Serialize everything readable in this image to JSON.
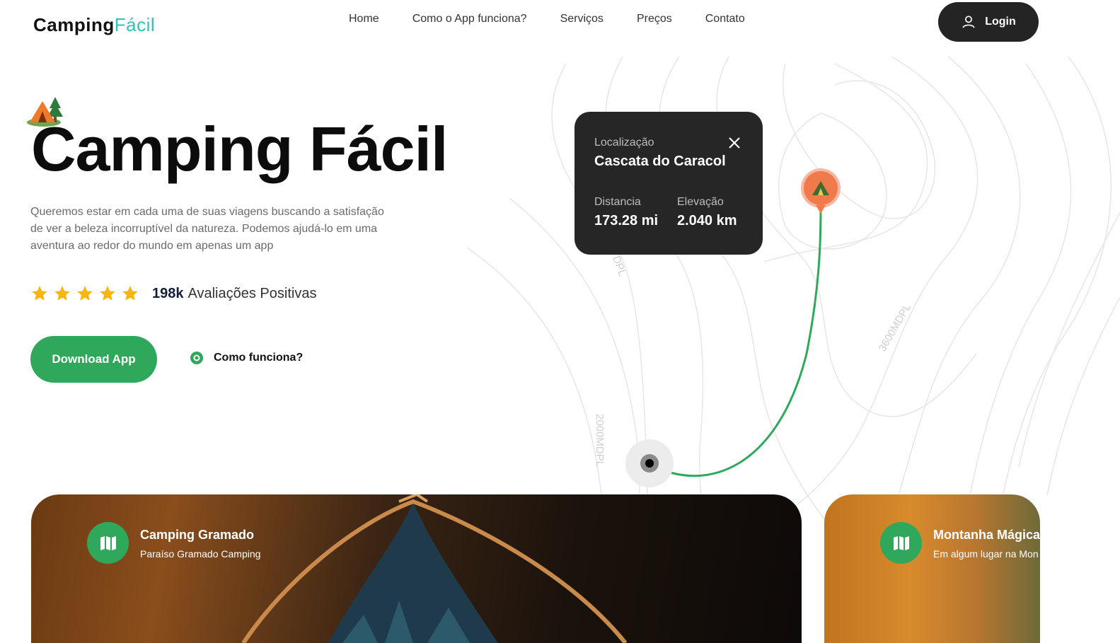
{
  "brand": {
    "name_part1": "Camping",
    "name_part2": "Fácil"
  },
  "nav": {
    "items": [
      "Home",
      "Como o App funciona?",
      "Serviços",
      "Preços",
      "Contato"
    ]
  },
  "header": {
    "login_label": "Login"
  },
  "hero": {
    "title": "Camping Fácil",
    "description": "Queremos estar em cada uma de suas viagens buscando a satisfação de ver a beleza incorruptível da natureza. Podemos ajudá-lo em uma aventura ao redor do mundo em apenas um app",
    "rating": {
      "stars": 5,
      "count": "198k",
      "label": "Avaliações Positivas"
    },
    "download_label": "Download App",
    "how_label": "Como funciona?"
  },
  "map": {
    "contour_labels": [
      "2000MDPL",
      "3600MDPL",
      "DPL"
    ],
    "info": {
      "location_label": "Localização",
      "location_name": "Cascata do Caracol",
      "distance_label": "Distancia",
      "distance_value": "173.28 mi",
      "elevation_label": "Elevação",
      "elevation_value": "2.040 km"
    }
  },
  "cards": [
    {
      "title": "Camping Gramado",
      "subtitle": "Paraíso Gramado Camping",
      "icon": "map-icon"
    },
    {
      "title": "Montanha Mágica",
      "subtitle": "Em algum lugar na Mon",
      "icon": "map-icon"
    }
  ],
  "colors": {
    "primary_green": "#2fa85c",
    "accent_teal": "#35c0b4",
    "dark": "#262626",
    "pin_orange": "#f07a4a",
    "star": "#f6b70a"
  }
}
